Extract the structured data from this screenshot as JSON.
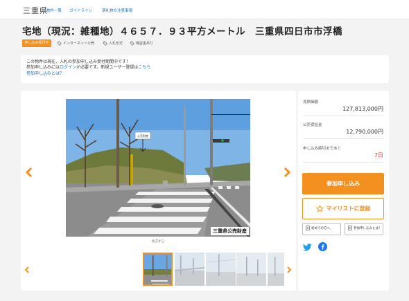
{
  "header": {
    "logo": "三重県",
    "nav": [
      "物件一覧",
      "ガイドライン",
      "落札物の注意事項"
    ]
  },
  "page_title": "宅地（現況：雑種地）４６５７．９３平方メートル　三重県四日市市浮橋",
  "status_badge": "申し込み受付中",
  "tags": [
    "インターネット公売",
    "入札形式",
    "保証金あり"
  ],
  "notice": {
    "line1": "この物件は現在、入札の参加申し込み受付期間中です！",
    "line2_pre": "参加申し込みには",
    "login_link": "ログイン",
    "line2_mid": "が必要です。新規ユーザー登録は",
    "register_link": "こちら",
    "help_link": "参加申し込みとは？"
  },
  "photo": {
    "sign_text": "公売財産",
    "watermark": "三重県公売財産",
    "caption": "北方から"
  },
  "side": {
    "estimate_label": "見積価額",
    "estimate_value": "127,813,000円",
    "deposit_label": "公売保証金",
    "deposit_value": "12,790,000円",
    "deadline_label": "申し込み締切まであと",
    "deadline_value": "7日",
    "apply_button": "参加申し込み",
    "favorite_button": "マイリストに登録",
    "first_time_button": "初めての方へ",
    "about_apply_button": "参加申し込みとは？"
  },
  "colors": {
    "accent": "#f3901f",
    "link": "#1a6fb8",
    "days": "#e23b3b",
    "twitter": "#1da1f2",
    "facebook": "#1877f2"
  }
}
